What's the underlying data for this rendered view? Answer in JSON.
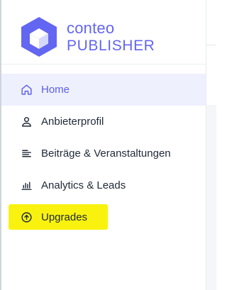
{
  "brand": {
    "line1": "conteo",
    "line2": "PUBLISHER",
    "color": "#6366f1"
  },
  "colors": {
    "accent": "#6366f1",
    "active_bg": "#eef0fe",
    "text": "#1f2937",
    "highlight": "#f9f20f"
  },
  "nav": {
    "items": [
      {
        "label": "Home",
        "icon": "home-icon",
        "active": true
      },
      {
        "label": "Anbieterprofil",
        "icon": "user-icon",
        "active": false
      },
      {
        "label": "Beiträge & Veranstaltungen",
        "icon": "list-icon",
        "active": false
      },
      {
        "label": "Analytics & Leads",
        "icon": "bar-chart-icon",
        "active": false
      },
      {
        "label": "Upgrades",
        "icon": "arrow-up-circle-icon",
        "active": false,
        "highlighted": true
      }
    ]
  }
}
